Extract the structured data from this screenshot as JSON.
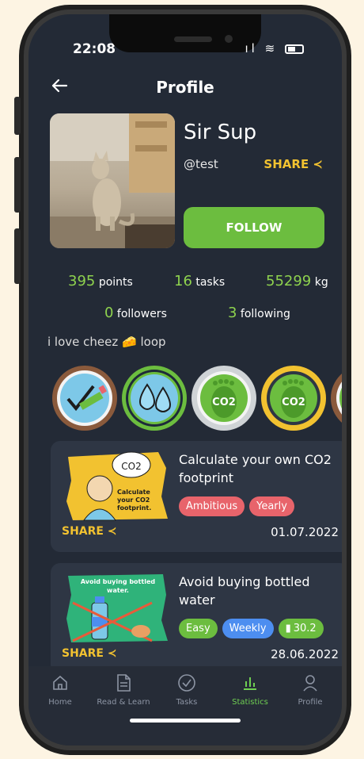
{
  "status": {
    "time": "22:08"
  },
  "header": {
    "back_icon": "arrow-left-icon",
    "title": "Profile"
  },
  "profile": {
    "name": "Sir Sup",
    "handle": "@test",
    "share_label": "SHARE",
    "follow_label": "FOLLOW"
  },
  "stats": {
    "points": {
      "value": "395",
      "label": "points"
    },
    "tasks": {
      "value": "16",
      "label": "tasks"
    },
    "kg": {
      "value": "55299",
      "label": "kg"
    },
    "followers": {
      "value": "0",
      "label": "followers"
    },
    "following": {
      "value": "3",
      "label": "following"
    }
  },
  "bio": {
    "text_before": "i love cheez",
    "emoji": "🧀",
    "text_after": "loop"
  },
  "badges": [
    {
      "name": "pencil-check-badge",
      "ring": "#8a5a3c",
      "fill": "#7dc8e8"
    },
    {
      "name": "water-drops-badge",
      "ring": "#6cbd3f",
      "fill": "#7dc8e8"
    },
    {
      "name": "co2-footprint-badge-silver",
      "ring": "#cfd3d6",
      "fill": "#6cbd3f"
    },
    {
      "name": "co2-footprint-badge-gold",
      "ring": "#f2c230",
      "fill": "#6cbd3f"
    },
    {
      "name": "co2-footprint-badge-bronze",
      "ring": "#8a5a3c",
      "fill": "#6cbd3f"
    }
  ],
  "tasks": [
    {
      "title": "Calculate your own CO2 footprint",
      "image_caption": "Calculate your CO2 footprint.",
      "tags": [
        {
          "label": "Ambitious",
          "color": "#e8646b"
        },
        {
          "label": "Yearly",
          "color": "#e8646b"
        }
      ],
      "share_label": "SHARE",
      "date": "01.07.2022"
    },
    {
      "title": "Avoid buying bottled water",
      "image_caption": "Avoid buying bottled water.",
      "tags": [
        {
          "label": "Easy",
          "color": "#6cbd3f"
        },
        {
          "label": "Weekly",
          "color": "#4d8ef0"
        },
        {
          "label": "30.2",
          "color": "#6cbd3f"
        }
      ],
      "share_label": "SHARE",
      "date": "28.06.2022"
    }
  ],
  "nav": {
    "items": [
      {
        "label": "Home",
        "icon": "home-icon"
      },
      {
        "label": "Read & Learn",
        "icon": "document-icon"
      },
      {
        "label": "Tasks",
        "icon": "check-circle-icon"
      },
      {
        "label": "Statistics",
        "icon": "bar-chart-icon"
      },
      {
        "label": "Profile",
        "icon": "person-icon"
      }
    ],
    "active": "Statistics"
  },
  "colors": {
    "accent_green": "#6cbd3f",
    "accent_yellow": "#f2c230",
    "background": "#232a36",
    "card": "#2e3644"
  }
}
